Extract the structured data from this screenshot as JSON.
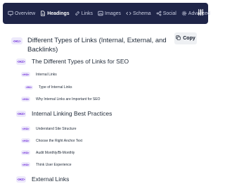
{
  "tabs": [
    {
      "label": "Overview",
      "icon": "monitor-icon",
      "active": false
    },
    {
      "label": "Headings",
      "icon": "document-icon",
      "active": true
    },
    {
      "label": "Links",
      "icon": "link-icon",
      "active": false
    },
    {
      "label": "Images",
      "icon": "image-icon",
      "active": false
    },
    {
      "label": "Schema",
      "icon": "code-icon",
      "active": false
    },
    {
      "label": "Social",
      "icon": "share-icon",
      "active": false
    },
    {
      "label": "Advanced",
      "icon": "gear-icon",
      "active": false
    }
  ],
  "copy_label": "Copy",
  "headings": [
    {
      "level": "<H1>",
      "text_line1": "Different Types of Links (Internal, External, and",
      "text_line2": "Backlinks)"
    },
    {
      "level": "<H2>",
      "text": "The Different Types of Links for SEO"
    },
    {
      "level": "<H3>",
      "text": "Internal Links"
    },
    {
      "level": "<H4>",
      "text": "Type of Internal Links"
    },
    {
      "level": "<H3>",
      "text": "Why Internal Links are Important for SEO"
    },
    {
      "level": "<H2>",
      "text": "Internal Linking Best Practices"
    },
    {
      "level": "<H3>",
      "text": "Understand Site Structure"
    },
    {
      "level": "<H3>",
      "text": "Choose the Right Anchor Text"
    },
    {
      "level": "<H3>",
      "text": "Audit Monthly/Bi-Monthly"
    },
    {
      "level": "<H3>",
      "text": "Think User Experience"
    },
    {
      "level": "<H2>",
      "text": "External Links"
    }
  ],
  "colors": {
    "nav_bg": "#1f2548",
    "badge_bg": "#ede9fb",
    "badge_text": "#6d28d9"
  }
}
